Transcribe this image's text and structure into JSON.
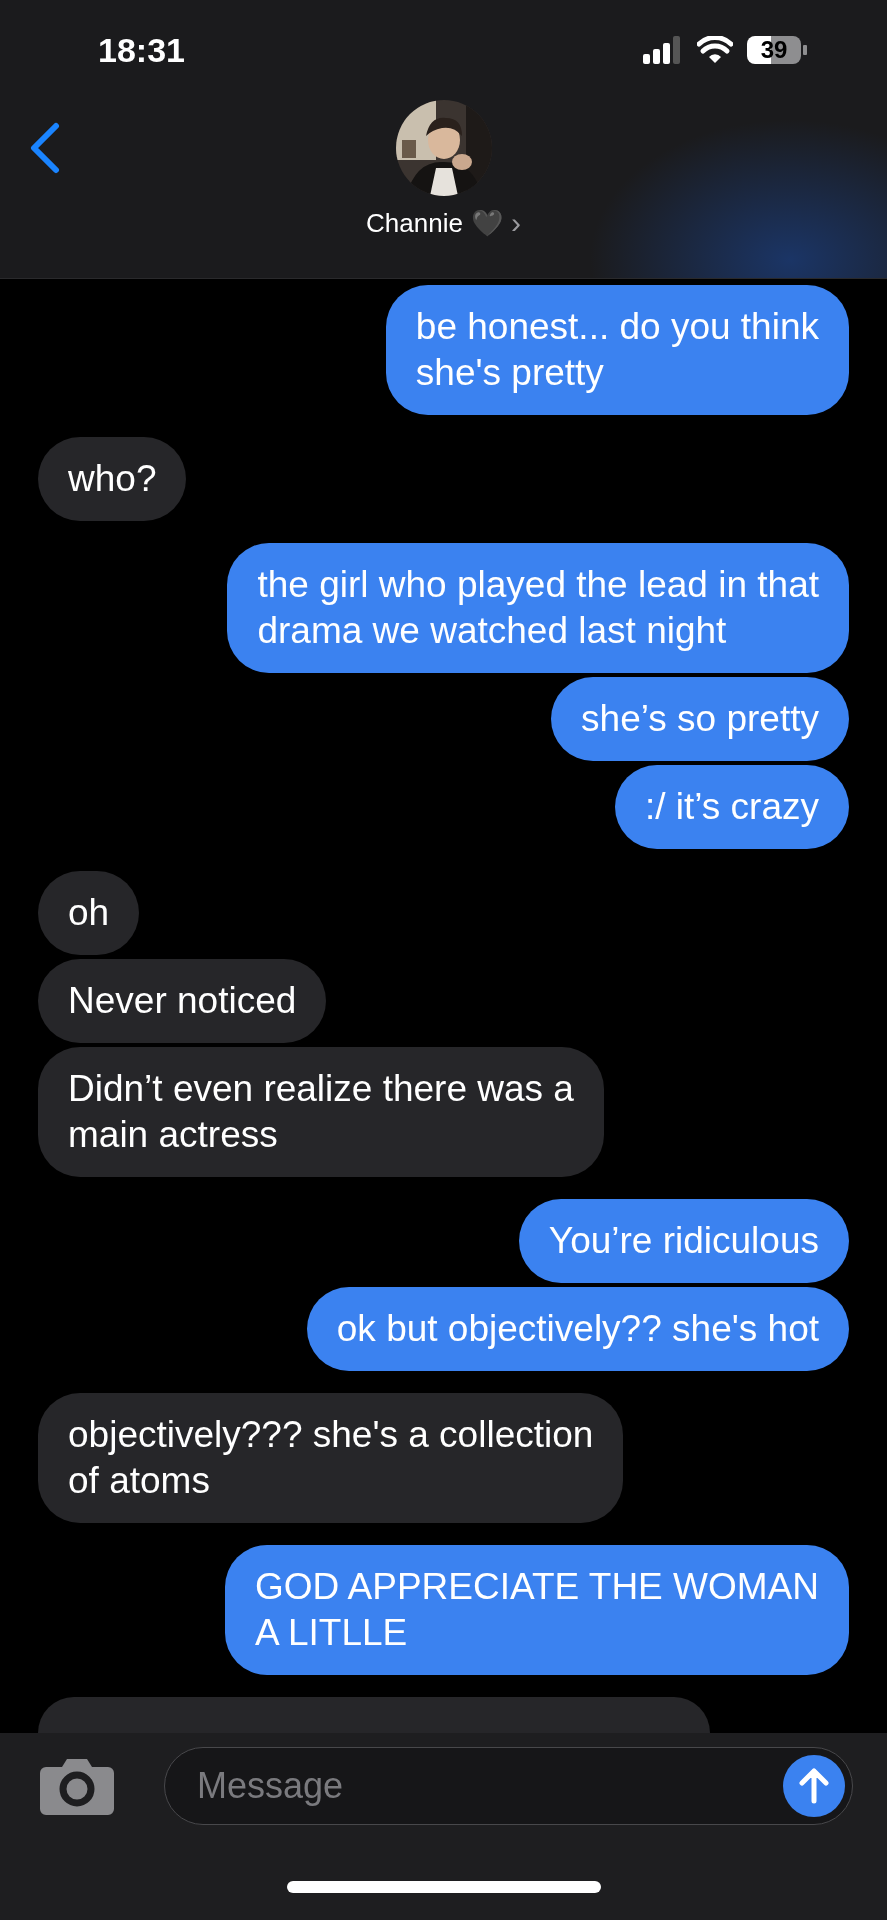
{
  "status_bar": {
    "time": "18:31",
    "battery": "39"
  },
  "header": {
    "contact_name": "Channie",
    "name_emoji": "🖤",
    "chevron": "›"
  },
  "messages": [
    {
      "kind": "bubble",
      "sent": true,
      "text": "be honest... do you think\nshe's pretty"
    },
    {
      "kind": "bubble",
      "sent": false,
      "text": "who?"
    },
    {
      "kind": "bubble",
      "sent": true,
      "text": "the girl who played the lead in that\ndrama we watched last night"
    },
    {
      "kind": "bubble",
      "sent": true,
      "text": "she’s so pretty"
    },
    {
      "kind": "bubble",
      "sent": true,
      "text": ":/ it’s crazy"
    },
    {
      "kind": "bubble",
      "sent": false,
      "text": "oh"
    },
    {
      "kind": "bubble",
      "sent": false,
      "text": "Never noticed"
    },
    {
      "kind": "bubble",
      "sent": false,
      "text": "Didn’t even realize there was a\nmain actress"
    },
    {
      "kind": "bubble",
      "sent": true,
      "text": "You’re ridiculous"
    },
    {
      "kind": "bubble",
      "sent": true,
      "text": "ok but objectively?? she's hot"
    },
    {
      "kind": "bubble",
      "sent": false,
      "text": "objectively??? she's a collection\nof atoms"
    },
    {
      "kind": "bubble",
      "sent": true,
      "text": "GOD APPRECIATE THE WOMAN\nA LITLLE"
    },
    {
      "kind": "hidden",
      "sent": false
    }
  ],
  "compose": {
    "placeholder": "Message"
  }
}
